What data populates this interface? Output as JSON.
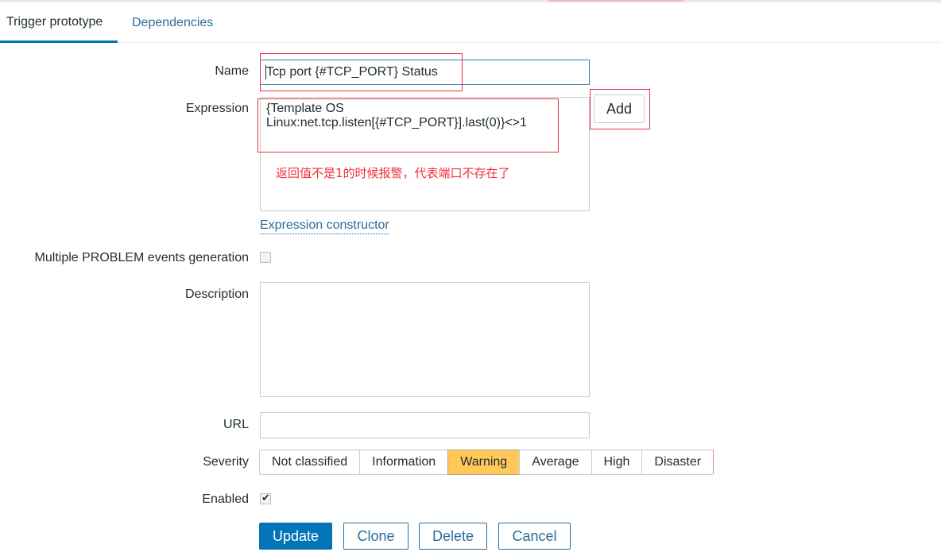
{
  "tabs": [
    {
      "label": "Trigger prototype",
      "active": true
    },
    {
      "label": "Dependencies",
      "active": false
    }
  ],
  "form": {
    "name": {
      "label": "Name",
      "value": "Tcp port {#TCP_PORT} Status"
    },
    "expression": {
      "label": "Expression",
      "value_line1": "{Template OS",
      "value_line2": "Linux:net.tcp.listen[{#TCP_PORT}].last(0)}<>1",
      "add_button": "Add",
      "constructor_link": "Expression constructor"
    },
    "annotation_note": "返回值不是1的时候报警，代表端口不存在了",
    "multiple_problem": {
      "label": "Multiple PROBLEM events generation",
      "checked": false
    },
    "description": {
      "label": "Description",
      "value": ""
    },
    "url": {
      "label": "URL",
      "value": ""
    },
    "severity": {
      "label": "Severity",
      "options": [
        "Not classified",
        "Information",
        "Warning",
        "Average",
        "High",
        "Disaster"
      ],
      "selected": "Warning"
    },
    "enabled": {
      "label": "Enabled",
      "checked": true,
      "tick": "✔"
    }
  },
  "actions": {
    "update": "Update",
    "clone": "Clone",
    "delete": "Delete",
    "cancel": "Cancel"
  },
  "colors": {
    "accent": "#0275b8",
    "link": "#2a6d9b",
    "warning_selected": "#ffc859",
    "annotation": "#e3343f"
  }
}
